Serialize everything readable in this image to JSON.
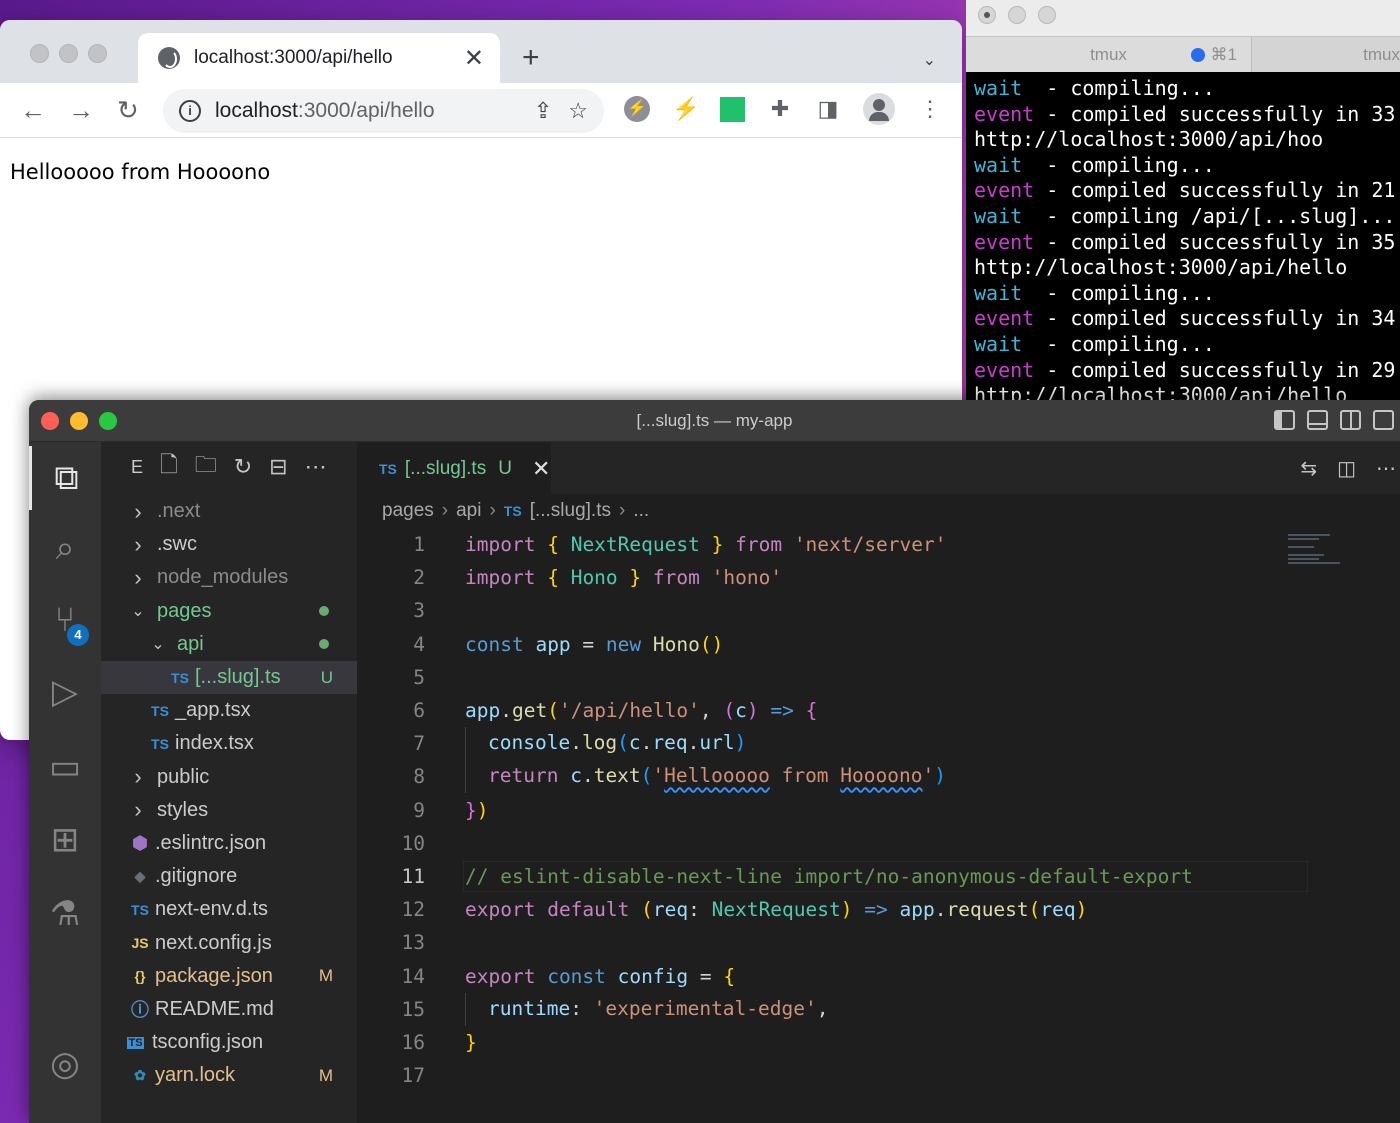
{
  "browser": {
    "tab_title": "localhost:3000/api/hello",
    "url_host": "localhost",
    "url_rest": ":3000/api/hello",
    "page_text": "Hellooooo from Hoooono"
  },
  "terminal": {
    "tab_active": "tmux",
    "tab_shortcut": "⌘1",
    "tab_other": "tmux",
    "log": [
      {
        "kind": "wait",
        "label": "wait",
        "text": "  - compiling..."
      },
      {
        "kind": "event",
        "label": "event",
        "text": " - compiled successfully in 33"
      },
      {
        "kind": "plain",
        "label": "",
        "text": "http://localhost:3000/api/hoo"
      },
      {
        "kind": "wait",
        "label": "wait",
        "text": "  - compiling..."
      },
      {
        "kind": "event",
        "label": "event",
        "text": " - compiled successfully in 21"
      },
      {
        "kind": "wait",
        "label": "wait",
        "text": "  - compiling /api/[...slug]..."
      },
      {
        "kind": "event",
        "label": "event",
        "text": " - compiled successfully in 35"
      },
      {
        "kind": "plain",
        "label": "",
        "text": "http://localhost:3000/api/hello"
      },
      {
        "kind": "wait",
        "label": "wait",
        "text": "  - compiling..."
      },
      {
        "kind": "event",
        "label": "event",
        "text": " - compiled successfully in 34"
      },
      {
        "kind": "wait",
        "label": "wait",
        "text": "  - compiling..."
      },
      {
        "kind": "event",
        "label": "event",
        "text": " - compiled successfully in 29"
      },
      {
        "kind": "plain",
        "label": "",
        "text": "http://localhost:3000/api/hello"
      }
    ]
  },
  "vscode": {
    "window_title": "[...slug].ts — my-app",
    "explorer_label": "E",
    "scm_badge": "4",
    "tree": [
      {
        "name": ".next",
        "depth": 0,
        "type": "folder",
        "open": false,
        "color": "dim"
      },
      {
        "name": ".swc",
        "depth": 0,
        "type": "folder",
        "open": false,
        "color": "normal"
      },
      {
        "name": "node_modules",
        "depth": 0,
        "type": "folder",
        "open": false,
        "color": "dim"
      },
      {
        "name": "pages",
        "depth": 0,
        "type": "folder",
        "open": true,
        "color": "green",
        "dot": true
      },
      {
        "name": "api",
        "depth": 1,
        "type": "folder",
        "open": true,
        "color": "green",
        "dot": true
      },
      {
        "name": "[...slug].ts",
        "depth": 2,
        "type": "ts",
        "color": "green",
        "status": "U",
        "selected": true
      },
      {
        "name": "_app.tsx",
        "depth": 1,
        "type": "ts",
        "color": "normal"
      },
      {
        "name": "index.tsx",
        "depth": 1,
        "type": "ts",
        "color": "normal"
      },
      {
        "name": "public",
        "depth": 0,
        "type": "folder",
        "open": false,
        "color": "normal"
      },
      {
        "name": "styles",
        "depth": 0,
        "type": "folder",
        "open": false,
        "color": "normal"
      },
      {
        "name": ".eslintrc.json",
        "depth": 0,
        "type": "eslint",
        "color": "normal"
      },
      {
        "name": ".gitignore",
        "depth": 0,
        "type": "git",
        "color": "normal"
      },
      {
        "name": "next-env.d.ts",
        "depth": 0,
        "type": "ts",
        "color": "normal"
      },
      {
        "name": "next.config.js",
        "depth": 0,
        "type": "js",
        "color": "normal"
      },
      {
        "name": "package.json",
        "depth": 0,
        "type": "json",
        "color": "yellow",
        "status": "M"
      },
      {
        "name": "README.md",
        "depth": 0,
        "type": "info",
        "color": "normal"
      },
      {
        "name": "tsconfig.json",
        "depth": 0,
        "type": "tsconfig",
        "color": "normal"
      },
      {
        "name": "yarn.lock",
        "depth": 0,
        "type": "yarn",
        "color": "yellow",
        "status": "M"
      }
    ],
    "editor_tab": {
      "icon": "TS",
      "name": "[...slug].ts",
      "status": "U"
    },
    "breadcrumbs": [
      "pages",
      "api",
      "[...slug].ts",
      "..."
    ],
    "current_line": 11,
    "code": [
      [
        [
          "k",
          "import"
        ],
        [
          "p",
          " "
        ],
        [
          "br1",
          "{"
        ],
        [
          "p",
          " "
        ],
        [
          "t",
          "NextRequest"
        ],
        [
          "p",
          " "
        ],
        [
          "br1",
          "}"
        ],
        [
          "p",
          " "
        ],
        [
          "k",
          "from"
        ],
        [
          "p",
          " "
        ],
        [
          "s",
          "'next/server'"
        ]
      ],
      [
        [
          "k",
          "import"
        ],
        [
          "p",
          " "
        ],
        [
          "br1",
          "{"
        ],
        [
          "p",
          " "
        ],
        [
          "t",
          "Hono"
        ],
        [
          "p",
          " "
        ],
        [
          "br1",
          "}"
        ],
        [
          "p",
          " "
        ],
        [
          "k",
          "from"
        ],
        [
          "p",
          " "
        ],
        [
          "s",
          "'hono'"
        ]
      ],
      [],
      [
        [
          "kb",
          "const"
        ],
        [
          "p",
          " "
        ],
        [
          "v",
          "app"
        ],
        [
          "p",
          " = "
        ],
        [
          "kb",
          "new"
        ],
        [
          "p",
          " "
        ],
        [
          "f",
          "Hono"
        ],
        [
          "br1",
          "()"
        ]
      ],
      [],
      [
        [
          "v",
          "app"
        ],
        [
          "p",
          "."
        ],
        [
          "f",
          "get"
        ],
        [
          "br1",
          "("
        ],
        [
          "s",
          "'/api/hello'"
        ],
        [
          "p",
          ", "
        ],
        [
          "br2",
          "("
        ],
        [
          "v",
          "c"
        ],
        [
          "br2",
          ")"
        ],
        [
          "p",
          " "
        ],
        [
          "kb",
          "=>"
        ],
        [
          "p",
          " "
        ],
        [
          "br2",
          "{"
        ]
      ],
      [
        [
          "guide",
          ""
        ],
        [
          "v",
          "console"
        ],
        [
          "p",
          "."
        ],
        [
          "f",
          "log"
        ],
        [
          "br3",
          "("
        ],
        [
          "v",
          "c"
        ],
        [
          "p",
          "."
        ],
        [
          "v",
          "req"
        ],
        [
          "p",
          "."
        ],
        [
          "v",
          "url"
        ],
        [
          "br3",
          ")"
        ]
      ],
      [
        [
          "guide",
          ""
        ],
        [
          "k",
          "return"
        ],
        [
          "p",
          " "
        ],
        [
          "v",
          "c"
        ],
        [
          "p",
          "."
        ],
        [
          "f",
          "text"
        ],
        [
          "br3",
          "("
        ],
        [
          "s",
          "'"
        ],
        [
          "sq",
          "Hellooooo"
        ],
        [
          "s",
          " from "
        ],
        [
          "sq",
          "Hoooono"
        ],
        [
          "s",
          "'"
        ],
        [
          "br3",
          ")"
        ]
      ],
      [
        [
          "br2",
          "}"
        ],
        [
          "br1",
          ")"
        ]
      ],
      [],
      [
        [
          "cm",
          "// eslint-disable-next-line import/no-anonymous-default-export"
        ]
      ],
      [
        [
          "k",
          "export"
        ],
        [
          "p",
          " "
        ],
        [
          "k",
          "default"
        ],
        [
          "p",
          " "
        ],
        [
          "br1",
          "("
        ],
        [
          "v",
          "req"
        ],
        [
          "p",
          ": "
        ],
        [
          "t",
          "NextRequest"
        ],
        [
          "br1",
          ")"
        ],
        [
          "p",
          " "
        ],
        [
          "kb",
          "=>"
        ],
        [
          "p",
          " "
        ],
        [
          "v",
          "app"
        ],
        [
          "p",
          "."
        ],
        [
          "f",
          "request"
        ],
        [
          "br1",
          "("
        ],
        [
          "v",
          "req"
        ],
        [
          "br1",
          ")"
        ]
      ],
      [],
      [
        [
          "k",
          "export"
        ],
        [
          "p",
          " "
        ],
        [
          "kb",
          "const"
        ],
        [
          "p",
          " "
        ],
        [
          "v",
          "config"
        ],
        [
          "p",
          " = "
        ],
        [
          "br1",
          "{"
        ]
      ],
      [
        [
          "guide",
          ""
        ],
        [
          "v",
          "runtime"
        ],
        [
          "p",
          ": "
        ],
        [
          "s",
          "'experimental-edge'"
        ],
        [
          "p",
          ","
        ]
      ],
      [
        [
          "br1",
          "}"
        ]
      ],
      []
    ]
  }
}
